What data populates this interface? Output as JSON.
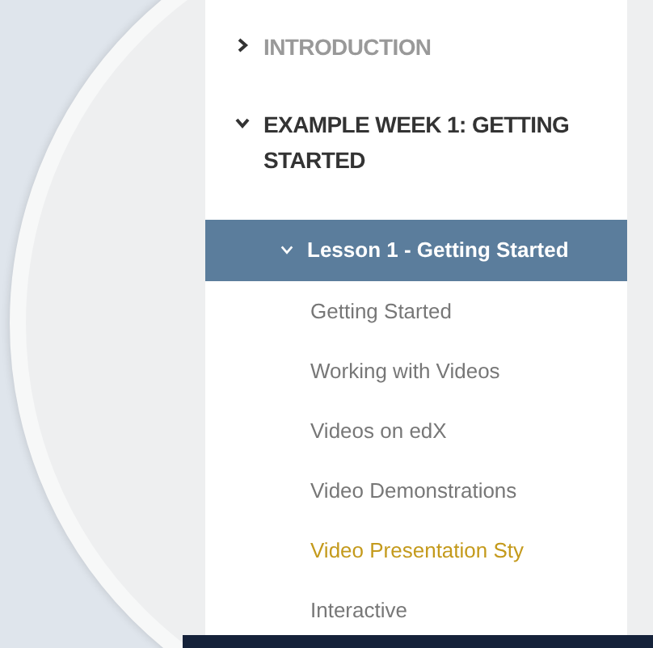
{
  "outline": [
    {
      "title": "INTRODUCTION",
      "expanded": false
    },
    {
      "title": "EXAMPLE WEEK 1: GETTING STARTED",
      "expanded": true,
      "children": [
        {
          "title": "Lesson 1 - Getting Started",
          "expanded": true,
          "selected": true,
          "children": [
            {
              "title": "Getting Started",
              "selected": false
            },
            {
              "title": "Working with Videos",
              "selected": false
            },
            {
              "title": "Videos on edX",
              "selected": false
            },
            {
              "title": "Video Demonstrations",
              "selected": false
            },
            {
              "title": "Video Presentation Sty",
              "selected": true
            },
            {
              "title": "Interactive",
              "selected": false
            }
          ]
        }
      ]
    }
  ]
}
